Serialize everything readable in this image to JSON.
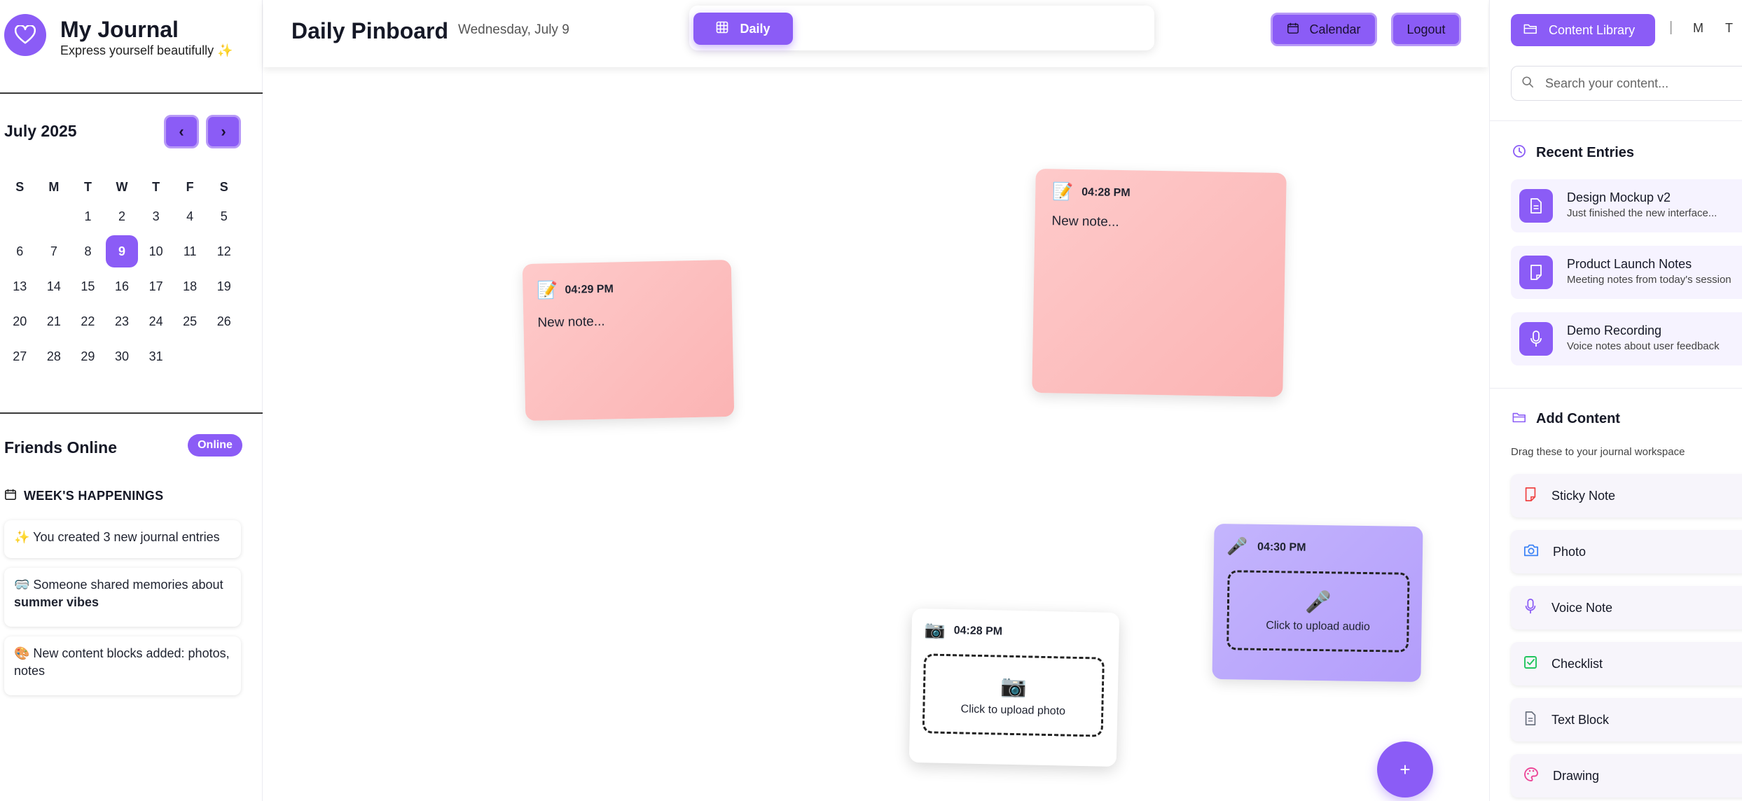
{
  "brand": {
    "title": "My Journal",
    "subtitle": "Express yourself beautifully ✨"
  },
  "calendar": {
    "month_label": "July 2025",
    "prev_label": "‹",
    "next_label": "›",
    "weekdays": [
      "S",
      "M",
      "T",
      "W",
      "T",
      "F",
      "S"
    ],
    "weeks": [
      [
        "",
        "",
        "1",
        "2",
        "3",
        "4",
        "5"
      ],
      [
        "6",
        "7",
        "8",
        "9",
        "10",
        "11",
        "12"
      ],
      [
        "13",
        "14",
        "15",
        "16",
        "17",
        "18",
        "19"
      ],
      [
        "20",
        "21",
        "22",
        "23",
        "24",
        "25",
        "26"
      ],
      [
        "27",
        "28",
        "29",
        "30",
        "31",
        "",
        ""
      ]
    ],
    "today": "9"
  },
  "friends": {
    "title": "Friends Online",
    "badge": "Online",
    "week_title": "WEEK'S HAPPENINGS",
    "happenings": [
      {
        "text": "✨ You created 3 new journal entries",
        "bold": ""
      },
      {
        "text": "🥽 Someone shared memories about ",
        "bold": "summer vibes"
      },
      {
        "text": "🎨 New content blocks added: photos, notes",
        "bold": ""
      }
    ]
  },
  "topbar": {
    "title": "Daily Pinboard",
    "date": "Wednesday, July 9",
    "daily_label": "Daily",
    "calendar_label": "Calendar",
    "logout_label": "Logout"
  },
  "canvas": {
    "notes": [
      {
        "time": "04:29 PM",
        "text": "New note...",
        "icon": "📝"
      },
      {
        "time": "04:28 PM",
        "text": "New note...",
        "icon": "📝"
      }
    ],
    "photo": {
      "time": "04:28 PM",
      "icon": "📷",
      "upload_label": "Click to upload photo"
    },
    "audio": {
      "time": "04:30 PM",
      "icon": "🎤",
      "upload_label": "Click to upload audio"
    },
    "fab_label": "+"
  },
  "panel": {
    "library_label": "Content Library",
    "separator": "|",
    "mode_m": "M",
    "mode_t": "T",
    "search_placeholder": "Search your content...",
    "recent_title": "Recent Entries",
    "recent": [
      {
        "title": "Design Mockup v2",
        "desc": "Just finished the new interface..."
      },
      {
        "title": "Product Launch Notes",
        "desc": "Meeting notes from today's session"
      },
      {
        "title": "Demo Recording",
        "desc": "Voice notes about user feedback"
      }
    ],
    "add_title": "Add Content",
    "add_sub": "Drag these to your journal workspace",
    "add_items": [
      {
        "label": "Sticky Note",
        "icon": "sticky-note-icon",
        "color": "#ef4444"
      },
      {
        "label": "Photo",
        "icon": "camera-icon",
        "color": "#3b82f6"
      },
      {
        "label": "Voice Note",
        "icon": "microphone-icon",
        "color": "#8b5cf6"
      },
      {
        "label": "Checklist",
        "icon": "checklist-icon",
        "color": "#22c55e"
      },
      {
        "label": "Text Block",
        "icon": "document-icon",
        "color": "#6b7280"
      },
      {
        "label": "Drawing",
        "icon": "palette-icon",
        "color": "#ec4899"
      }
    ]
  },
  "colors": {
    "accent": "#8b5cf6",
    "pink_note": "#fecaca",
    "purple_note": "#c4b5fd"
  }
}
